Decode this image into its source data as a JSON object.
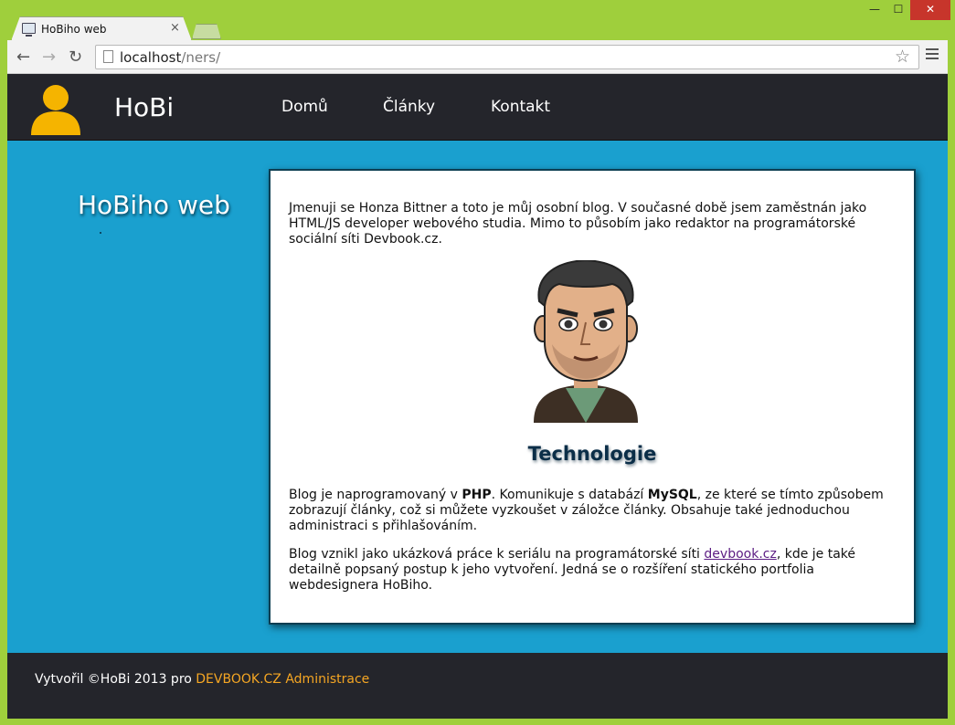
{
  "browser": {
    "tab_title": "HoBiho web",
    "tab_close": "×",
    "url_host": "localhost",
    "url_path": "/ners/",
    "win_min": "—",
    "win_max": "☐",
    "win_close": "✕"
  },
  "header": {
    "site_name": "HoBi",
    "nav": [
      {
        "label": "Domů"
      },
      {
        "label": "Články"
      },
      {
        "label": "Kontakt"
      }
    ]
  },
  "sidebar": {
    "title": "HoBiho web"
  },
  "content": {
    "intro": "Jmenuji se Honza Bittner a toto je můj osobní blog. V současné době jsem zaměstnán jako HTML/JS developer webového studia. Mimo to působím jako redaktor na programátorské sociální síti Devbook.cz.",
    "section_title": "Technologie",
    "tech_p_a": "Blog je naprogramovaný v ",
    "tech_php": "PHP",
    "tech_p_b": ". Komunikuje s databází ",
    "tech_mysql": "MySQL",
    "tech_p_c": ", ze které se tímto způsobem zobrazují články, což si můžete vyzkoušet v záložce články. Obsahuje také jednoduchou administraci s přihlašováním.",
    "origin_a": "Blog vznikl jako ukázková práce k seriálu na programátorské síti ",
    "origin_link": "devbook.cz",
    "origin_b": ", kde je také detailně popsaný postup k jeho vytvoření. Jedná se o rozšíření statického portfolia webdesignera HoBiho."
  },
  "footer": {
    "text": "Vytvořil ©HoBi 2013 pro ",
    "link_devbook": "DEVBOOK.CZ",
    "link_admin": "Administrace"
  },
  "colors": {
    "page_bg": "#1aa0cf",
    "header_bg": "#24252b",
    "accent": "#f5a623",
    "avatar": "#f5b400"
  }
}
